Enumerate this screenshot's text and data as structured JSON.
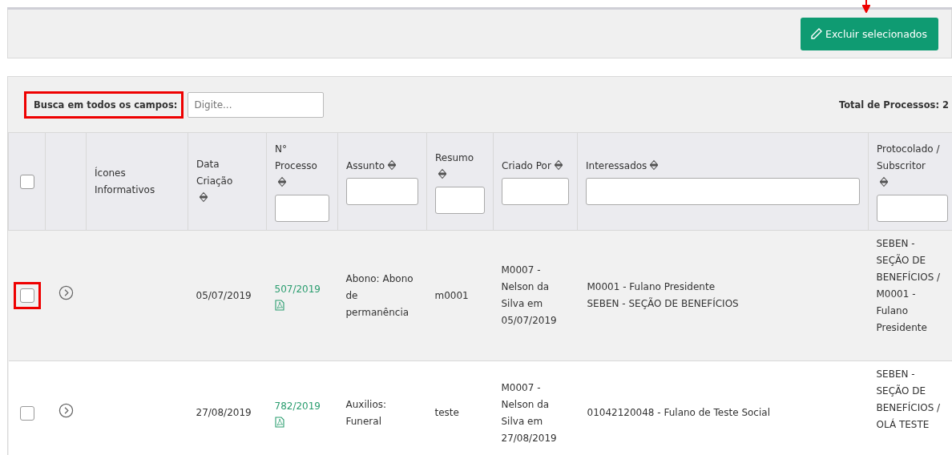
{
  "toolbar": {
    "button": "Excluir selecionados",
    "annotated": true
  },
  "search": {
    "label": "Busca em todos os campos:",
    "placeholder": "Digite...",
    "highlighted": true
  },
  "total": "Total de Processos: 2",
  "columns": [
    {
      "kind": "checkbox",
      "checked": false
    },
    {
      "kind": "blank"
    },
    {
      "kind": "text",
      "label": "Ícones Informativos"
    },
    {
      "kind": "text",
      "label": "Data Criação",
      "sortable": true,
      "filter": false
    },
    {
      "kind": "text",
      "label": "N° Processo",
      "sortable": true,
      "filter": true
    },
    {
      "kind": "text",
      "label": "Assunto",
      "sortable": true,
      "filter": true
    },
    {
      "kind": "text",
      "label": "Resumo",
      "sortable": true,
      "filter": true
    },
    {
      "kind": "text",
      "label": "Criado Por",
      "sortable": true,
      "filter": true
    },
    {
      "kind": "text",
      "label": "Interessados",
      "sortable": true,
      "filter": true
    },
    {
      "kind": "text",
      "label": "Protocolado / Subscritor",
      "sortable": true,
      "filter": true
    }
  ],
  "rows": [
    {
      "checked": false,
      "highlighted": true,
      "hovered": true,
      "date": "05/07/2019",
      "process": "507/2019",
      "subject": "Abono: Abono de permanência",
      "summary": "m0001",
      "created_by": "M0007 - Nelson da Silva em 05/07/2019",
      "interested": [
        "M0001 - Fulano Presidente",
        "SEBEN - SEÇÃO DE BENEFÍCIOS"
      ],
      "protocol": "SEBEN - SEÇÃO DE BENEFÍCIOS / M0001 - Fulano Presidente"
    },
    {
      "checked": false,
      "highlighted": false,
      "hovered": false,
      "date": "27/08/2019",
      "process": "782/2019",
      "subject": "Auxilios: Funeral",
      "summary": "teste",
      "created_by": "M0007 - Nelson da Silva em 27/08/2019",
      "interested": [
        "01042120048 - Fulano de Teste Social"
      ],
      "protocol": "SEBEN - SEÇÃO DE BENEFÍCIOS / OLÁ TESTE"
    }
  ]
}
